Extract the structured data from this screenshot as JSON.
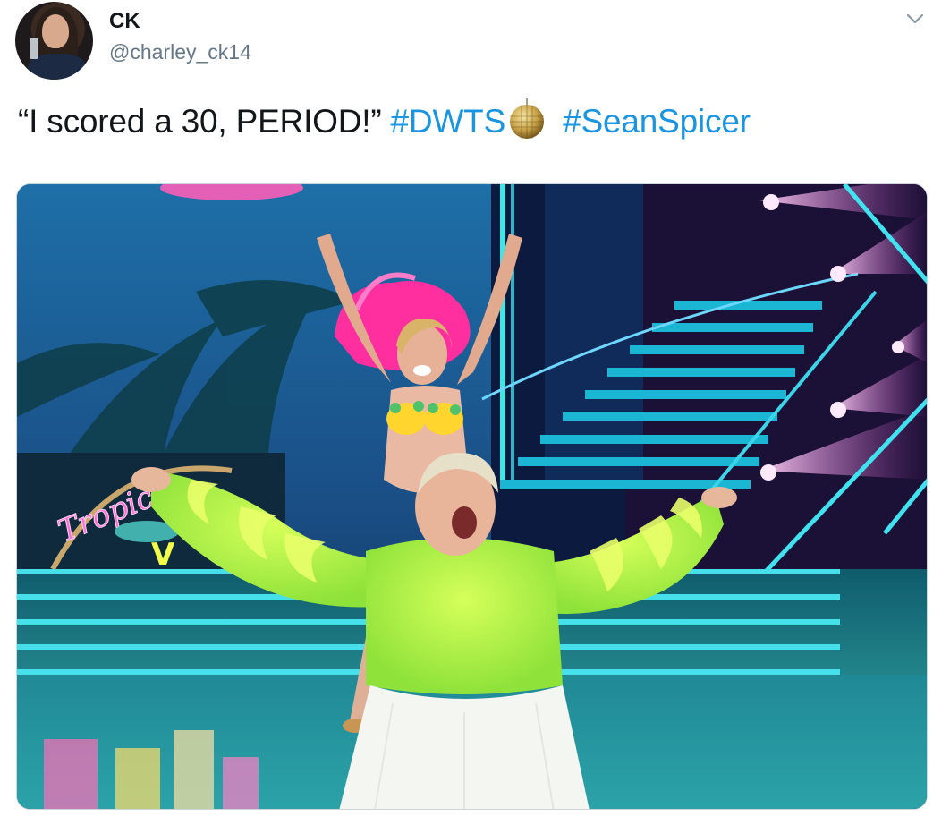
{
  "author": {
    "display_name": "CK",
    "handle": "@charley_ck14",
    "avatar_icon": "user-avatar-icon"
  },
  "tweet": {
    "text_prefix": "“I scored a 30, PERIOD!”",
    "hashtags": [
      "#DWTS",
      "#SeanSpicer"
    ],
    "emoji": "mirror-ball-icon"
  },
  "media": {
    "description_icon": "photo-icon",
    "neon_sign_text": "Tropica"
  },
  "colors": {
    "hashtag": "#1b95e0",
    "text": "#14171a",
    "secondary": "#657786"
  }
}
